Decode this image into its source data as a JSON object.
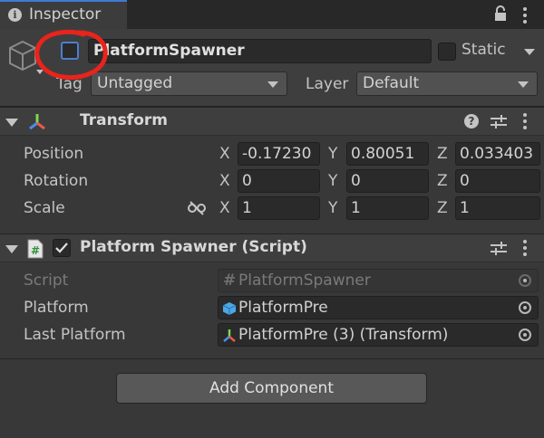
{
  "tab": {
    "title": "Inspector",
    "info_icon": "info-icon"
  },
  "gameobject": {
    "name": "PlatformSpawner",
    "static_label": "Static",
    "tag_label": "Tag",
    "tag_value": "Untagged",
    "layer_label": "Layer",
    "layer_value": "Default"
  },
  "transform": {
    "title": "Transform",
    "rows": [
      {
        "label": "Position",
        "x": "-0.17230",
        "y": "0.80051",
        "z": "0.033403"
      },
      {
        "label": "Rotation",
        "x": "0",
        "y": "0",
        "z": "0"
      },
      {
        "label": "Scale",
        "x": "1",
        "y": "1",
        "z": "1"
      }
    ],
    "axes": {
      "x": "X",
      "y": "Y",
      "z": "Z"
    }
  },
  "script_component": {
    "title": "Platform Spawner (Script)",
    "fields": [
      {
        "label": "Script",
        "value": "PlatformSpawner"
      },
      {
        "label": "Platform",
        "value": "PlatformPre"
      },
      {
        "label": "Last Platform",
        "value": "PlatformPre (3) (Transform)"
      }
    ]
  },
  "add_component_label": "Add Component",
  "colors": {
    "annotation": "#e8241c",
    "accent": "#3d7bd6",
    "background": "#383838"
  }
}
